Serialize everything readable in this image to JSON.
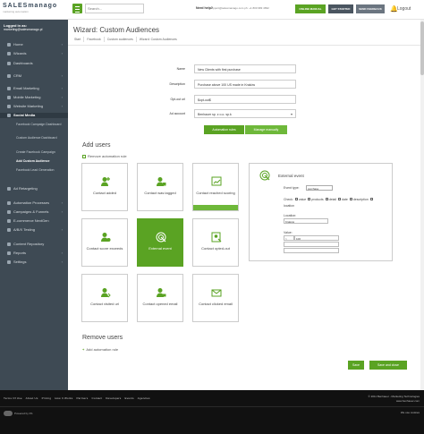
{
  "header": {
    "logo_text": "SALESmanago",
    "logo_sub": "marketing automation",
    "search_placeholder": "Search...",
    "need_help": "Need help?",
    "contact_info": "support@salesmanago.com ph: +1 800 983 4832",
    "btn_manual": "ONLINE MANUAL",
    "btn_started": "GET STARTED",
    "btn_feedback": "SEND FEEDBACK",
    "logout": "Logout"
  },
  "sidebar": {
    "logged_in_label": "Logged in as:",
    "user_email": "marketing@salesmanago.pl",
    "items": [
      {
        "label": "Home"
      },
      {
        "label": "Wizards"
      },
      {
        "label": "Dashboards"
      },
      {
        "label": "CRM"
      },
      {
        "label": "Email Marketing"
      },
      {
        "label": "Mobile Marketing"
      },
      {
        "label": "Website Marketing"
      },
      {
        "label": "Social Media"
      },
      {
        "label": "Ad Retargeting"
      },
      {
        "label": "Automation Processes"
      },
      {
        "label": "Campaigns & Funnels"
      },
      {
        "label": "E-commerce NextGen"
      },
      {
        "label": "A/B/X Testing"
      },
      {
        "label": "Content Repository"
      },
      {
        "label": "Reports"
      },
      {
        "label": "Settings"
      }
    ],
    "subitems": [
      {
        "label": "Facebook Campaign Dashboard"
      },
      {
        "label": "Custom Audience Dashboard"
      },
      {
        "label": "Create Facebook Campaign"
      },
      {
        "label": "Add Custom Audience"
      },
      {
        "label": "Facebook Lead Generation"
      }
    ]
  },
  "page": {
    "title": "Wizard: Custom Audiences",
    "breadcrumbs": [
      "Start",
      "Facebook",
      "Custom audiences",
      "Wizard: Custom Audiences"
    ]
  },
  "form": {
    "name_label": "Name",
    "name_value": "New Clients with first purchase",
    "description_label": "Description",
    "description_value": "Purchase above 100 US made in Kraków",
    "optout_label": "Opt-out url",
    "optout_value": "$opt-out$",
    "adaccount_label": "Ad account",
    "adaccount_value": "Benhauer sp. z o.o. sp.k",
    "btn_automation": "Automation rules",
    "btn_manual": "Manage manually"
  },
  "add_users": {
    "title": "Add users",
    "remove_rule": "Remove automation rule",
    "cards": [
      {
        "label": "Contact added",
        "icon": "user-plus-icon"
      },
      {
        "label": "Contact was tagged",
        "icon": "user-tag-icon"
      },
      {
        "label": "Contact reached scoring",
        "icon": "chart-icon"
      },
      {
        "label": "Contact score exceeds",
        "icon": "user-score-icon"
      },
      {
        "label": "External event",
        "icon": "target-icon"
      },
      {
        "label": "Contact opted-out",
        "icon": "opt-out-icon"
      },
      {
        "label": "Contact visited url",
        "icon": "user-url-icon"
      },
      {
        "label": "Contact opened email",
        "icon": "user-email-icon"
      },
      {
        "label": "Contact clicked email",
        "icon": "email-icon"
      }
    ]
  },
  "external_event": {
    "title": "External event",
    "event_type_label": "Event type:",
    "event_type_value": "purchase",
    "check_label": "Check:",
    "checks": [
      "value",
      "products",
      "detail",
      "date",
      "description"
    ],
    "location_check": "location",
    "location_label": "Location:",
    "location_value": "Kraków",
    "value_label": "Value:",
    "value_op": ">",
    "value_value": "100"
  },
  "remove_users": {
    "title": "Remove users",
    "add_rule": "Add automation rule"
  },
  "actions": {
    "save": "Save",
    "save_close": "Save and close"
  },
  "footer": {
    "links": [
      "Terms Of Use",
      "About Us",
      "Pricing",
      "How It Works",
      "Partners",
      "Contact",
      "Developers",
      "Events",
      "Agencies"
    ],
    "copyright": "© 2011 Benhauer - Marketing Technologies",
    "site": "www.benhauer.com",
    "cookies": "We use cookies",
    "powered": "Powered by 3S"
  },
  "colors": {
    "accent": "#5aa323",
    "sidebar": "#3e4a54",
    "footer": "#111111"
  }
}
